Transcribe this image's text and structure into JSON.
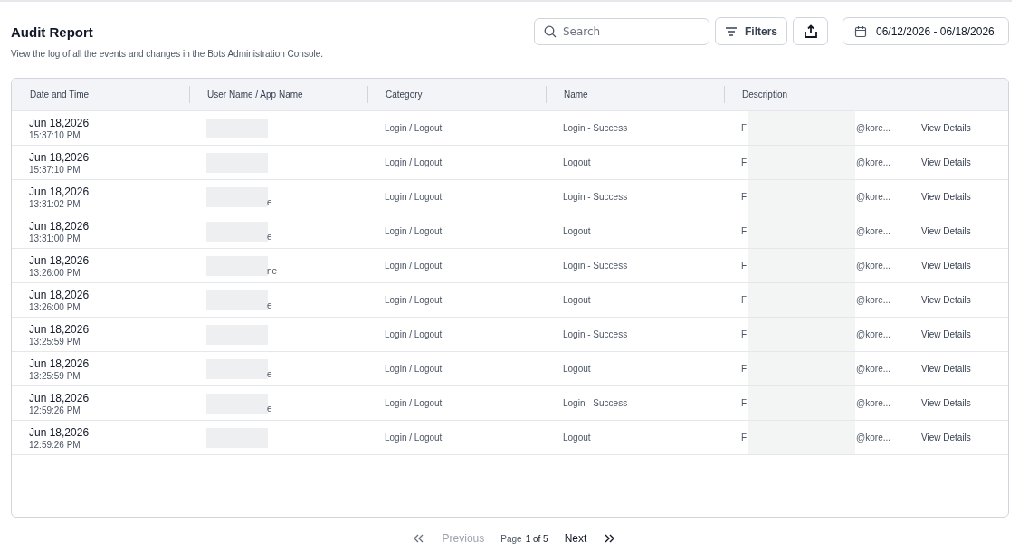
{
  "header": {
    "title": "Audit Report",
    "subtitle": "View the log of all the events and changes in the Bots Administration Console."
  },
  "toolbar": {
    "search": {
      "placeholder": "Search"
    },
    "filters_button": "Filters",
    "date_range": "06/12/2026 - 06/18/2026"
  },
  "table": {
    "columns": [
      "Date and Time",
      "User Name / App Name",
      "Category",
      "Name",
      "Description"
    ],
    "rows": [
      {
        "date": "Jun 18,2026",
        "time": "15:37:10 PM",
        "user_fragment": "",
        "category": "Login / Logout",
        "name": "Login - Success",
        "description_start": "F",
        "description_end": "@kore...",
        "action": "View Details"
      },
      {
        "date": "Jun 18,2026",
        "time": "15:37:10 PM",
        "user_fragment": "",
        "category": "Login / Logout",
        "name": "Logout",
        "description_start": "F",
        "description_end": "@kore...",
        "action": "View Details"
      },
      {
        "date": "Jun 18,2026",
        "time": "13:31:02 PM",
        "user_fragment": "e",
        "category": "Login / Logout",
        "name": "Login - Success",
        "description_start": "F",
        "description_end": "@kore...",
        "action": "View Details"
      },
      {
        "date": "Jun 18,2026",
        "time": "13:31:00 PM",
        "user_fragment": "e",
        "category": "Login / Logout",
        "name": "Logout",
        "description_start": "F",
        "description_end": "@kore...",
        "action": "View Details"
      },
      {
        "date": "Jun 18,2026",
        "time": "13:26:00 PM",
        "user_fragment": "ne",
        "category": "Login / Logout",
        "name": "Login - Success",
        "description_start": "F",
        "description_end": "@kore...",
        "action": "View Details"
      },
      {
        "date": "Jun 18,2026",
        "time": "13:26:00 PM",
        "user_fragment": "e",
        "category": "Login / Logout",
        "name": "Logout",
        "description_start": "F",
        "description_end": "@kore...",
        "action": "View Details"
      },
      {
        "date": "Jun 18,2026",
        "time": "13:25:59 PM",
        "user_fragment": "",
        "category": "Login / Logout",
        "name": "Login - Success",
        "description_start": "F",
        "description_end": "@kore...",
        "action": "View Details"
      },
      {
        "date": "Jun 18,2026",
        "time": "13:25:59 PM",
        "user_fragment": "e",
        "category": "Login / Logout",
        "name": "Logout",
        "description_start": "F",
        "description_end": "@kore...",
        "action": "View Details"
      },
      {
        "date": "Jun 18,2026",
        "time": "12:59:26 PM",
        "user_fragment": "e",
        "category": "Login / Logout",
        "name": "Login - Success",
        "description_start": "F",
        "description_end": "@kore...",
        "action": "View Details"
      },
      {
        "date": "Jun 18,2026",
        "time": "12:59:26 PM",
        "user_fragment": "",
        "category": "Login / Logout",
        "name": "Logout",
        "description_start": "F",
        "description_end": "@kore...",
        "action": "View Details"
      }
    ]
  },
  "pagination": {
    "previous": {
      "label": "Previous",
      "disabled": true
    },
    "page_label": "Page",
    "page_value": "1 of 5",
    "next": {
      "label": "Next",
      "disabled": false
    }
  }
}
